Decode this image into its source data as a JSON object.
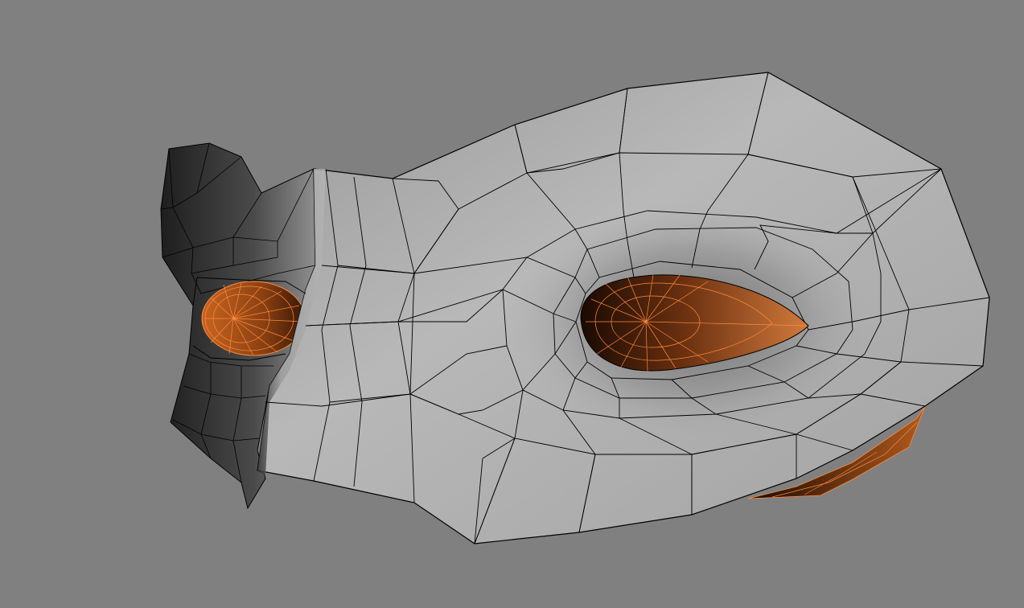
{
  "viewport": {
    "background_color": "#808080",
    "mesh_surface_color": "#b4b4b4",
    "mesh_shadow_color": "#1a1a1a",
    "wireframe_color": "#000000",
    "eye_color": "#c86420",
    "eye_shadow_color": "#2a1406",
    "eye_wire_color": "#ff8a3c"
  }
}
